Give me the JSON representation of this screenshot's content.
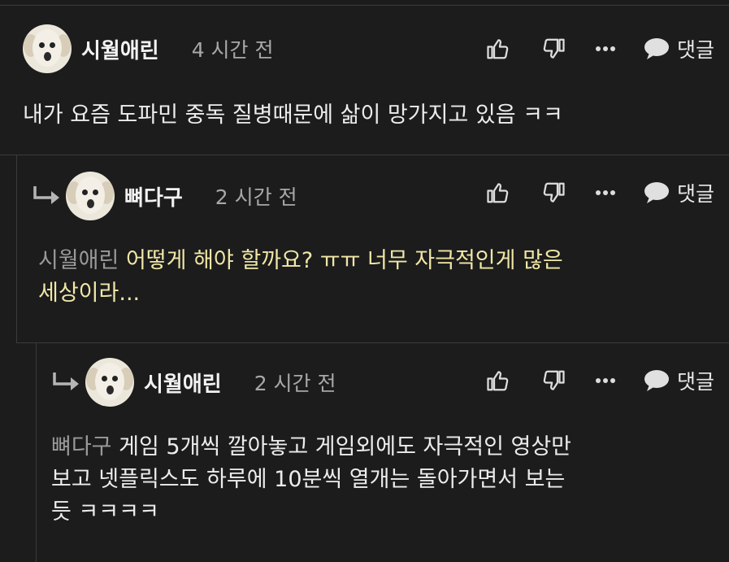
{
  "actions": {
    "reply_label": "댓글"
  },
  "comments": [
    {
      "author": "시월애린",
      "time": "4 시간 전",
      "mention": "",
      "text": "내가 요즘 도파민 중독 질병때문에 삶이 망가지고 있음 ㅋㅋ"
    },
    {
      "author": "뼈다구",
      "time": "2 시간 전",
      "mention": "시월애린",
      "text_line1": "어떻게 해야 할까요? ㅠㅠ 너무 자극적인게 많은",
      "text_line2": "세상이라...",
      "text_color": "#f0e7a6"
    },
    {
      "author": "시월애린",
      "time": "2 시간 전",
      "mention": "뼈다구",
      "text_line1": "게임 5개씩 깔아놓고 게임외에도 자극적인 영상만",
      "text_line2": "보고 넷플릭스도 하루에 10분씩 열개는 돌아가면서 보는",
      "text_line3": "듯 ㅋㅋㅋㅋ"
    }
  ],
  "icons": [
    "thumbs-up-icon",
    "thumbs-down-icon",
    "more-icon",
    "speech-bubble-icon",
    "reply-arrow-icon",
    "dog-avatar"
  ]
}
